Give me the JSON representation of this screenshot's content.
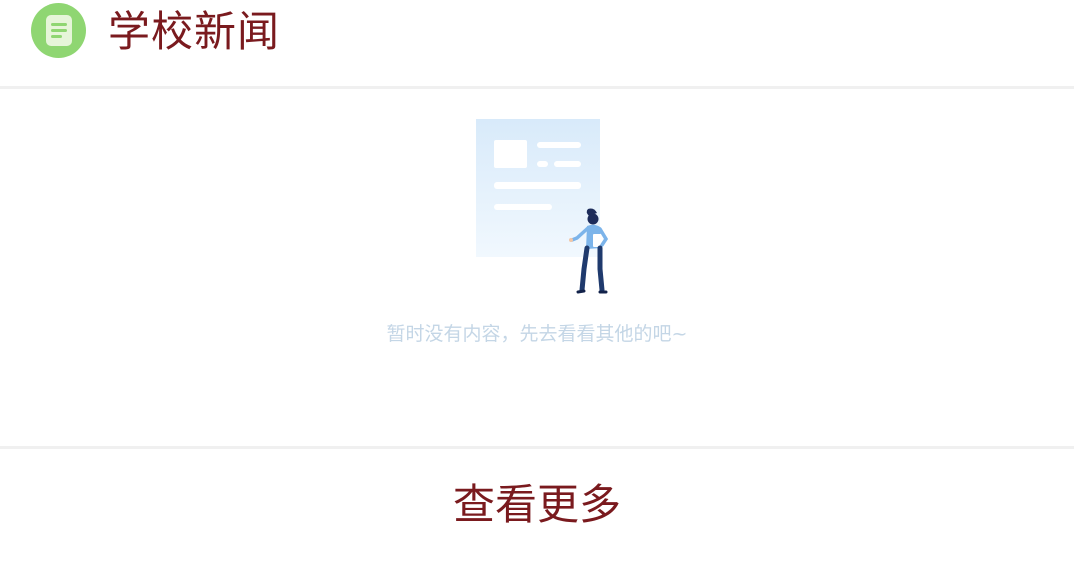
{
  "section": {
    "title": "学校新闻",
    "icon": "news-document-icon",
    "icon_color": "#8fd672",
    "title_color": "#7a1a1e"
  },
  "empty_state": {
    "illustration": "empty-content-illustration",
    "message": "暂时没有内容，先去看看其他的吧~",
    "message_color": "#c4d6e6"
  },
  "footer": {
    "more_label": "查看更多"
  }
}
